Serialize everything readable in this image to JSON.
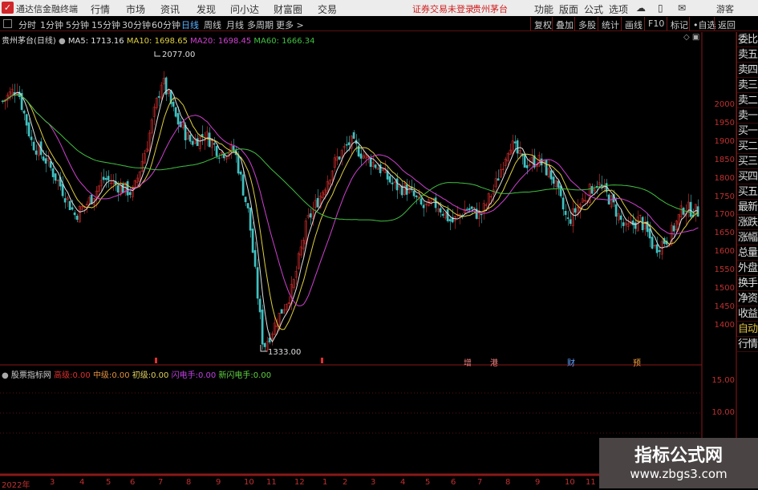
{
  "app": {
    "title": "通达信金融终端",
    "menu": [
      "行情",
      "市场",
      "资讯",
      "发现",
      "问小达",
      "财富圈",
      "交易"
    ],
    "status": "证券交易未登录",
    "stock": "贵州茅台",
    "right_menu": [
      "功能",
      "版面",
      "公式",
      "选项"
    ],
    "user": "游客"
  },
  "toolbar": {
    "periods": [
      "分时",
      "1分钟",
      "5分钟",
      "15分钟",
      "30分钟",
      "60分钟",
      "日线",
      "周线",
      "月线",
      "多周期",
      "更多 >"
    ],
    "active": "日线",
    "buttons": [
      "复权",
      "叠加",
      "多股",
      "统计",
      "画线",
      "F10",
      "标记",
      "•自选",
      "返回"
    ]
  },
  "info": {
    "title": "贵州茅台(日线)",
    "ma5": "MA5: 1713.16",
    "ma10": "MA10: 1698.65",
    "ma20": "MA20: 1698.45",
    "ma60": "MA60: 1666.34"
  },
  "colors": {
    "ma5": "#e0e0e0",
    "ma10": "#e0d040",
    "ma20": "#d040d0",
    "ma60": "#40c040",
    "up": "#e03030",
    "down": "#40c0c0",
    "grid": "#5a1010"
  },
  "price_axis": [
    "2000",
    "1950",
    "1900",
    "1850",
    "1800",
    "1750",
    "1700",
    "1650",
    "1600",
    "1550",
    "1500",
    "1450",
    "1400"
  ],
  "annotations": {
    "high": "2077.00",
    "low": "1333.00"
  },
  "price_path": [
    2010,
    2050,
    1900,
    1850,
    1780,
    1700,
    1740,
    1800,
    1780,
    1760,
    1900,
    2070,
    1960,
    1900,
    1920,
    1870,
    1880,
    1700,
    1340,
    1420,
    1500,
    1680,
    1760,
    1850,
    1900,
    1860,
    1830,
    1780,
    1770,
    1720,
    1730,
    1680,
    1720,
    1700,
    1780,
    1900,
    1840,
    1850,
    1800,
    1680,
    1740,
    1790,
    1740,
    1660,
    1690,
    1610,
    1640,
    1720,
    1710
  ],
  "markers": [
    "增",
    "港",
    "财",
    "预"
  ],
  "sidebar": [
    "委比",
    "卖五",
    "卖四",
    "卖三",
    "卖二",
    "卖一",
    "买一",
    "买二",
    "买三",
    "买四",
    "买五",
    "最新",
    "涨跌",
    "涨幅",
    "总量",
    "外盘",
    "换手",
    "净资",
    "收益",
    "自动",
    "行情"
  ],
  "indicator": {
    "name": "股票指标网",
    "l1": "高级:",
    "v1": "0.00",
    "l2": "中级:",
    "v2": "0.00",
    "l3": "初级:",
    "v3": "0.00",
    "l4": "闪电手:",
    "v4": "0.00",
    "l5": "新闪电手:",
    "v5": "0.00",
    "axis": [
      "15.00",
      "10.00"
    ]
  },
  "x_axis": [
    "2022年",
    "3",
    "4",
    "5",
    "6",
    "7",
    "8",
    "9",
    "10",
    "11",
    "12",
    "1",
    "2",
    "3",
    "4",
    "5",
    "6",
    "7",
    "8",
    "9",
    "10",
    "11"
  ],
  "watermark": {
    "title": "指标公式网",
    "url": "www.zbgs3.com"
  }
}
